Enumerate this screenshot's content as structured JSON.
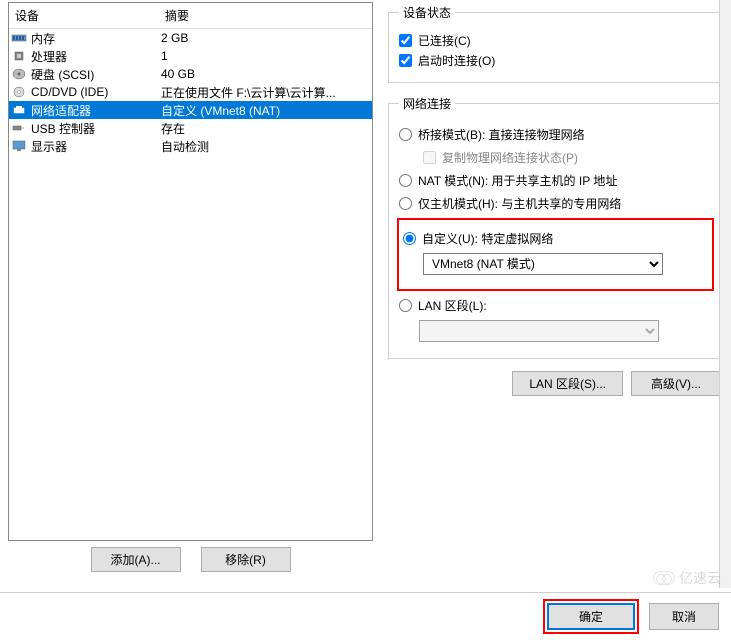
{
  "table": {
    "header_device": "设备",
    "header_summary": "摘要",
    "rows": [
      {
        "icon": "memory",
        "name": "内存",
        "summary": "2 GB"
      },
      {
        "icon": "cpu",
        "name": "处理器",
        "summary": "1"
      },
      {
        "icon": "disk",
        "name": "硬盘 (SCSI)",
        "summary": "40 GB"
      },
      {
        "icon": "cd",
        "name": "CD/DVD (IDE)",
        "summary": "正在使用文件 F:\\云计算\\云计算..."
      },
      {
        "icon": "network",
        "name": "网络适配器",
        "summary": "自定义 (VMnet8 (NAT)",
        "selected": true
      },
      {
        "icon": "usb",
        "name": "USB 控制器",
        "summary": "存在"
      },
      {
        "icon": "display",
        "name": "显示器",
        "summary": "自动检测"
      }
    ]
  },
  "left_buttons": {
    "add": "添加(A)...",
    "remove": "移除(R)"
  },
  "device_status": {
    "legend": "设备状态",
    "connected": "已连接(C)",
    "connect_at_start": "启动时连接(O)"
  },
  "network_connection": {
    "legend": "网络连接",
    "bridged": "桥接模式(B): 直接连接物理网络",
    "replicate": "复制物理网络连接状态(P)",
    "nat": "NAT 模式(N): 用于共享主机的 IP 地址",
    "hostonly": "仅主机模式(H): 与主机共享的专用网络",
    "custom": "自定义(U): 特定虚拟网络",
    "custom_value": "VMnet8 (NAT 模式)",
    "lan_segment": "LAN 区段(L):"
  },
  "right_buttons": {
    "lan_segments": "LAN 区段(S)...",
    "advanced": "高级(V)..."
  },
  "bottom": {
    "ok": "确定",
    "cancel": "取消"
  },
  "watermark": "亿速云"
}
